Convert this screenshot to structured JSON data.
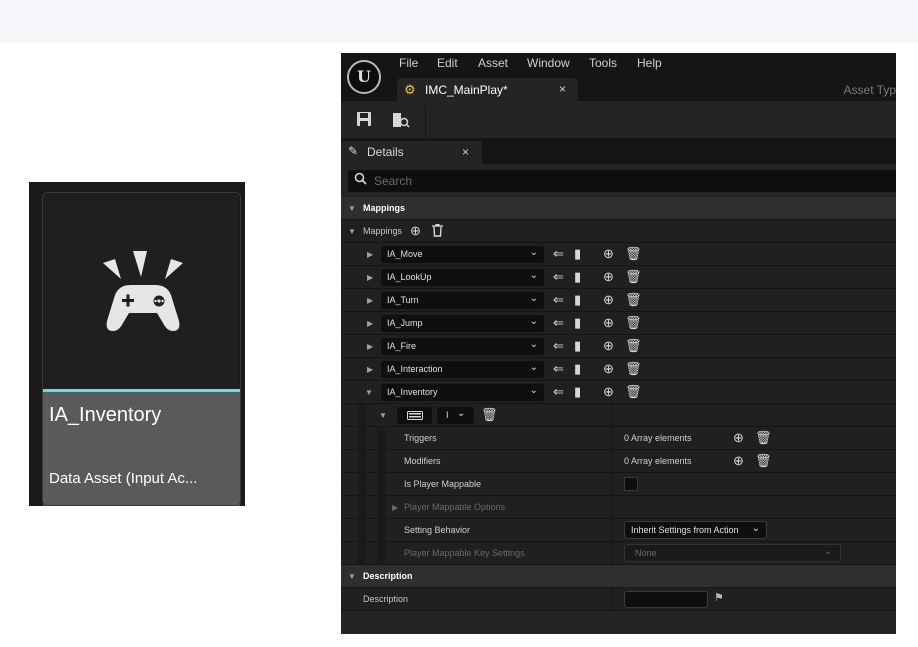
{
  "asset_tile": {
    "name": "IA_Inventory",
    "type_label": "Data Asset (Input Ac...",
    "accent_color": "#67d9f2",
    "icon": "gamepad-icon"
  },
  "editor": {
    "logo": "U",
    "menu": [
      "File",
      "Edit",
      "Asset",
      "Window",
      "Tools",
      "Help"
    ],
    "document_tab": {
      "label": "IMC_MainPlay*",
      "close": "×",
      "icon": "input-mapping-context-icon"
    },
    "asset_type_label": "Asset Typ",
    "toolbar": {
      "save_icon": "save-icon",
      "browse_icon": "browse-to-asset-icon"
    },
    "details_tab": {
      "label": "Details",
      "close": "×",
      "icon": "pencil-icon"
    },
    "search": {
      "placeholder": "Search",
      "value": ""
    },
    "sections": {
      "mappings_header": "Mappings",
      "mappings_array_label": "Mappings",
      "description_header": "Description",
      "description_label": "Description"
    },
    "mappings": [
      {
        "action": "IA_Move",
        "expanded": false
      },
      {
        "action": "IA_LookUp",
        "expanded": false
      },
      {
        "action": "IA_Turn",
        "expanded": false
      },
      {
        "action": "IA_Jump",
        "expanded": false
      },
      {
        "action": "IA_Fire",
        "expanded": false
      },
      {
        "action": "IA_Interaction",
        "expanded": false
      },
      {
        "action": "IA_Inventory",
        "expanded": true
      }
    ],
    "key_row": {
      "key_icon": "keyboard-icon",
      "key_value": "I"
    },
    "properties": {
      "triggers": {
        "label": "Triggers",
        "value": "0 Array elements"
      },
      "modifiers": {
        "label": "Modifiers",
        "value": "0 Array elements"
      },
      "is_player_mappable": {
        "label": "Is Player Mappable",
        "checked": false
      },
      "player_mappable_options": {
        "label": "Player Mappable Options"
      },
      "setting_behavior": {
        "label": "Setting Behavior",
        "value": "Inherit Settings from Action"
      },
      "player_mappable_key_settings": {
        "label": "Player Mappable Key Settings",
        "value": "None"
      }
    }
  }
}
